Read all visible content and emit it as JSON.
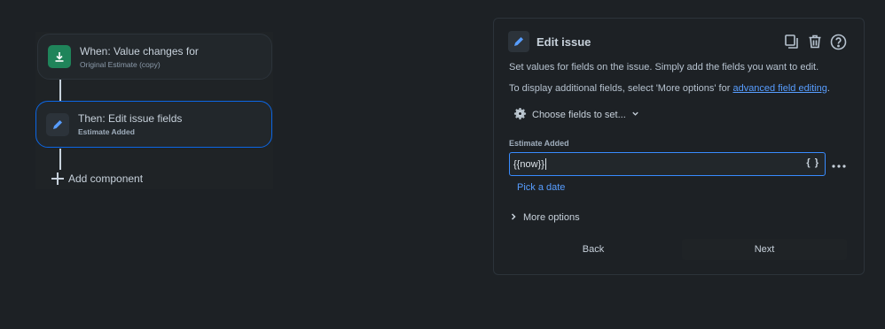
{
  "flow": {
    "trigger": {
      "title": "When: Value changes for",
      "subtitle": "Original Estimate (copy)",
      "icon": "download-tray-icon"
    },
    "action": {
      "title": "Then: Edit issue fields",
      "subtitle": "Estimate Added",
      "icon": "pencil-icon"
    },
    "add_label": "Add component"
  },
  "panel": {
    "title": "Edit issue",
    "desc1": "Set values for fields on the issue. Simply add the fields you want to edit.",
    "desc2_prefix": "To display additional fields, select 'More options' for ",
    "desc2_link": "advanced field editing",
    "desc2_suffix": ".",
    "choose_label": "Choose fields to set...",
    "field_label": "Estimate Added",
    "field_value": "{{now}}",
    "braces": "{ }",
    "pick_date": "Pick a date",
    "more_options": "More options",
    "back": "Back",
    "next": "Next"
  },
  "colors": {
    "background": "#1d2125",
    "accent": "#0c66e4",
    "link": "#579dff",
    "trigger_icon_bg": "#1f845a"
  }
}
